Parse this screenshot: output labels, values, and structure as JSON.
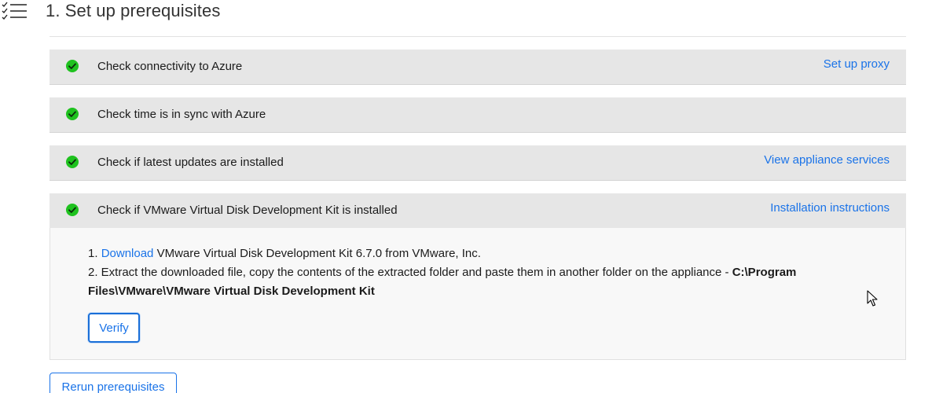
{
  "header": {
    "title": "1. Set up prerequisites",
    "icon": "checklist-icon"
  },
  "checks": [
    {
      "label": "Check connectivity to Azure",
      "status": "passed",
      "link": "Set up proxy"
    },
    {
      "label": "Check time is in sync with Azure",
      "status": "passed",
      "link": ""
    },
    {
      "label": "Check if latest updates are installed",
      "status": "passed",
      "link": "View appliance services"
    },
    {
      "label": "Check if VMware Virtual Disk Development Kit is installed",
      "status": "passed",
      "link": "Installation instructions"
    }
  ],
  "details": {
    "step1_prefix": "1. ",
    "step1_link": "Download",
    "step1_text": " VMware Virtual Disk Development Kit 6.7.0 from VMware, Inc.",
    "step2_text": "2. Extract the downloaded file, copy the contents of the extracted folder and paste them in another folder on the appliance - ",
    "step2_path": "C:\\Program Files\\VMware\\VMware Virtual Disk Development Kit",
    "verify_label": "Verify"
  },
  "actions": {
    "rerun_label": "Rerun prerequisites"
  },
  "colors": {
    "accent": "#1a73e8",
    "success": "#1fc21f",
    "row_background": "#e6e6e6"
  }
}
